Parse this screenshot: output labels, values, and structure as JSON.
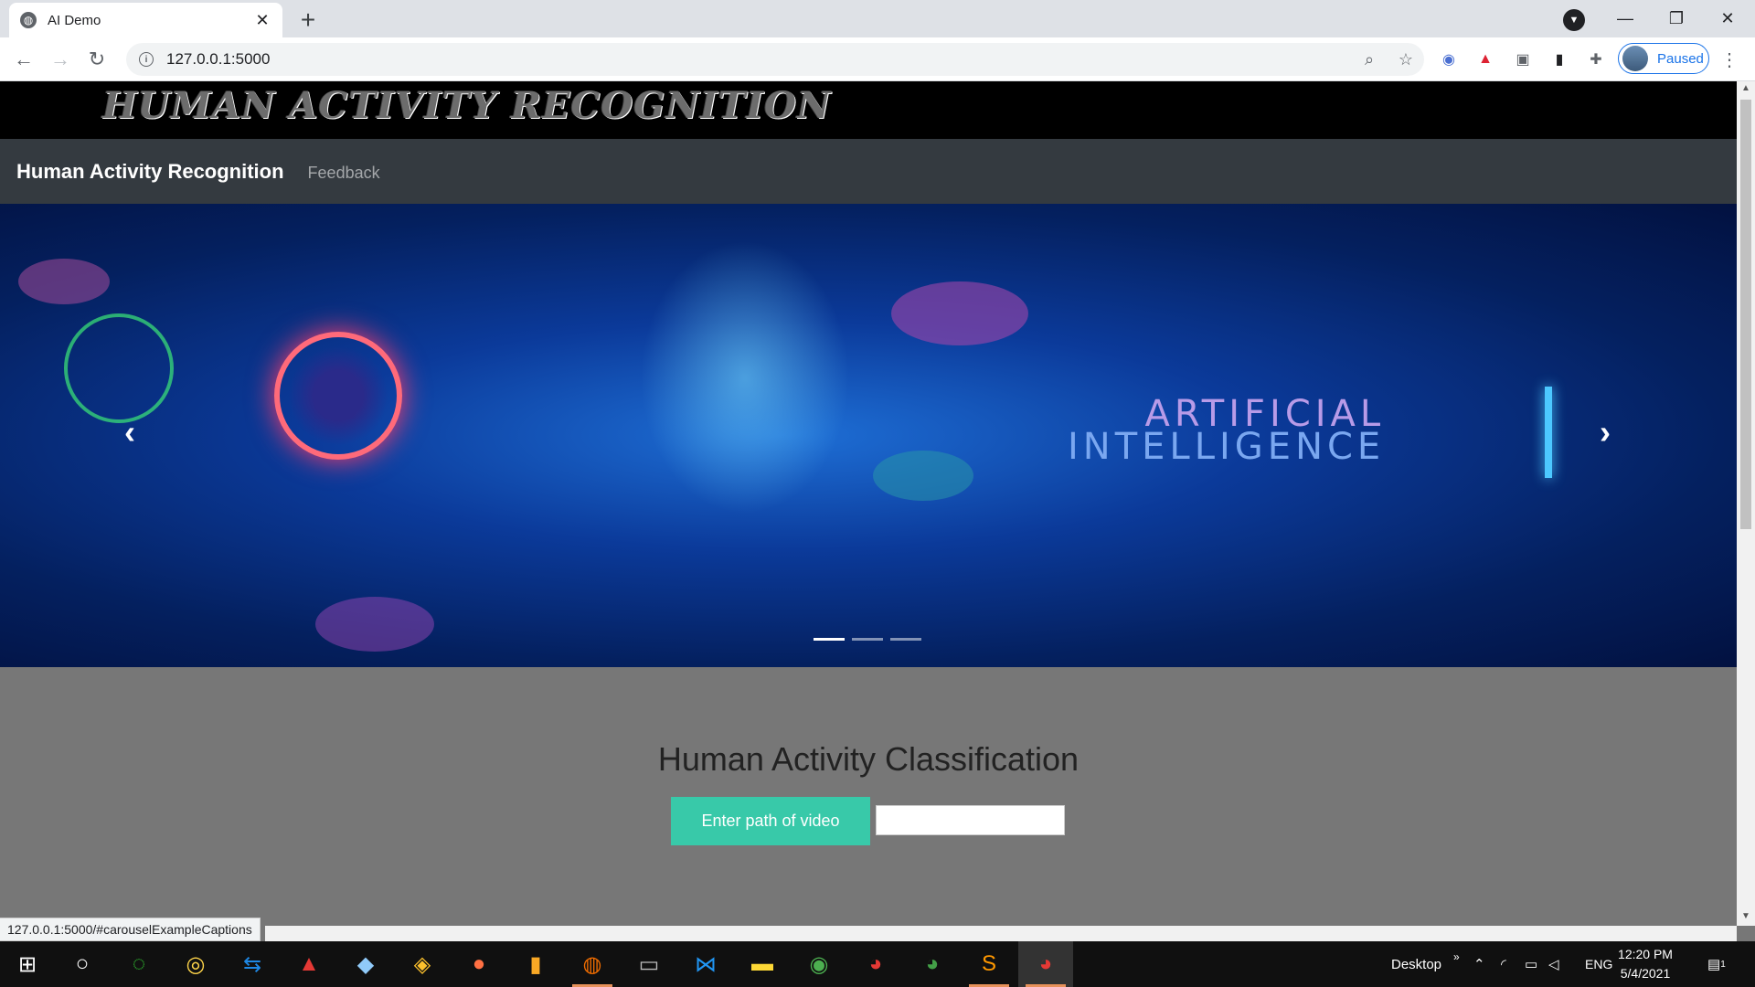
{
  "browser": {
    "tab_title": "AI Demo",
    "tab_close": "✕",
    "new_tab": "+",
    "url": "127.0.0.1:5000",
    "profile_label": "Paused",
    "minimize": "—",
    "restore": "❐",
    "close": "✕",
    "back": "←",
    "forward": "→",
    "reload": "↻",
    "zoom_icon": "⌕",
    "star_icon": "☆",
    "menu": "⋮"
  },
  "site": {
    "header_brand": "HUMAN ACTIVITY RECOGNITION",
    "navbar_brand": "Human Activity Recognition",
    "nav_link": "Feedback"
  },
  "carousel": {
    "text_line1": "ARTIFICIAL",
    "text_line2": "INTELLIGENCE",
    "prev": "‹",
    "next": "›",
    "slides": 3,
    "active_slide": 1
  },
  "classification": {
    "heading": "Human Activity Classification",
    "button_label": "Enter path of video",
    "input_value": ""
  },
  "status_url": "127.0.0.1:5000/#carouselExampleCaptions",
  "taskbar": {
    "desktop_label": "Desktop",
    "language": "ENG",
    "time": "12:20 PM",
    "date": "5/4/2021",
    "notification_count": "1"
  }
}
